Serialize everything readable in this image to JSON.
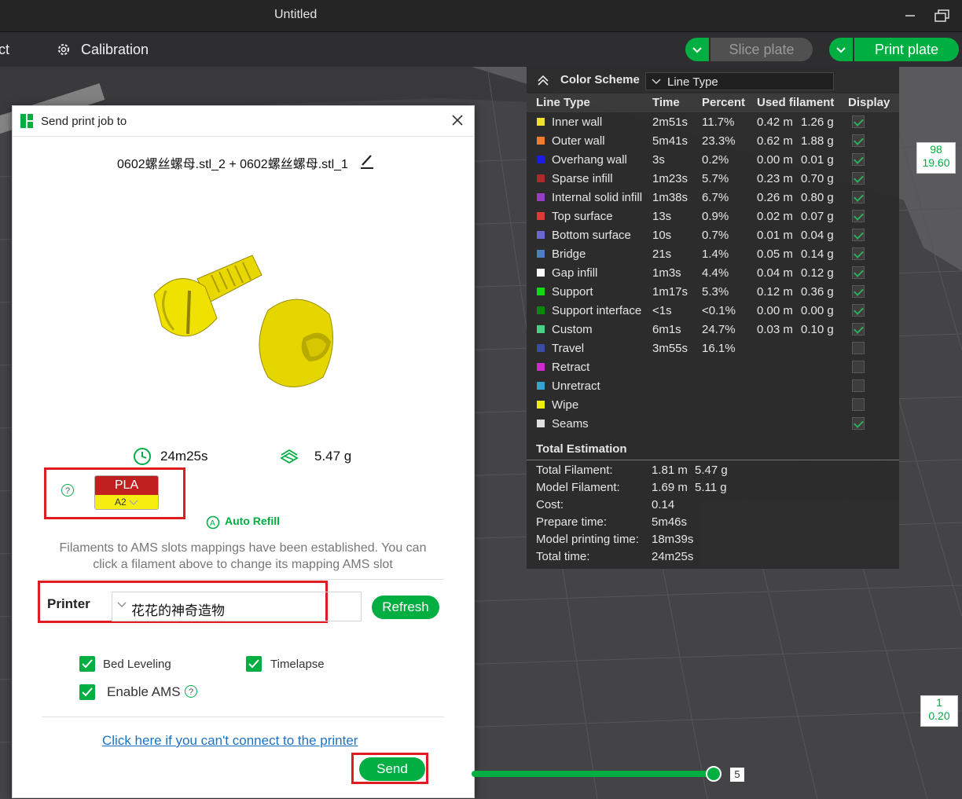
{
  "window": {
    "title": "Untitled"
  },
  "toolbar": {
    "partial_tab": "ct",
    "calibration": "Calibration",
    "slice_plate": "Slice plate",
    "print_plate": "Print plate"
  },
  "dialog": {
    "title": "Send print job to",
    "file_name": "0602螺丝螺母.stl_2 + 0602螺丝螺母.stl_1",
    "time": "24m25s",
    "weight": "5.47 g",
    "filament": {
      "type": "PLA",
      "slot": "A2",
      "color": "#c0201f",
      "slot_color": "#f5ee0e"
    },
    "help": "?",
    "auto_refill": "Auto Refill",
    "ams_message": "Filaments to AMS slots mappings have been established. You can click a filament above to change its mapping AMS slot",
    "printer_label": "Printer",
    "printer_value": "花花的神奇造物",
    "refresh": "Refresh",
    "options": {
      "bed_leveling": "Bed Leveling",
      "timelapse": "Timelapse",
      "enable_ams": "Enable AMS"
    },
    "link": "Click here if you can't connect to the printer",
    "send": "Send"
  },
  "legend": {
    "title": "Color Scheme",
    "scheme": "Line Type",
    "columns": {
      "type": "Line Type",
      "time": "Time",
      "percent": "Percent",
      "used": "Used filament",
      "display": "Display"
    },
    "rows": [
      {
        "name": "Inner wall",
        "color": "#f7e62d",
        "time": "2m51s",
        "percent": "11.7%",
        "m": "0.42 m",
        "g": "1.26 g",
        "on": true
      },
      {
        "name": "Outer wall",
        "color": "#f57f2d",
        "time": "5m41s",
        "percent": "23.3%",
        "m": "0.62 m",
        "g": "1.88 g",
        "on": true
      },
      {
        "name": "Overhang wall",
        "color": "#1a1aea",
        "time": "3s",
        "percent": "0.2%",
        "m": "0.00 m",
        "g": "0.01 g",
        "on": true
      },
      {
        "name": "Sparse infill",
        "color": "#b02b2b",
        "time": "1m23s",
        "percent": "5.7%",
        "m": "0.23 m",
        "g": "0.70 g",
        "on": true
      },
      {
        "name": "Internal solid infill",
        "color": "#9a3fc8",
        "time": "1m38s",
        "percent": "6.7%",
        "m": "0.26 m",
        "g": "0.80 g",
        "on": true
      },
      {
        "name": "Top surface",
        "color": "#e23a3a",
        "time": "13s",
        "percent": "0.9%",
        "m": "0.02 m",
        "g": "0.07 g",
        "on": true
      },
      {
        "name": "Bottom surface",
        "color": "#6b6bd6",
        "time": "10s",
        "percent": "0.7%",
        "m": "0.01 m",
        "g": "0.04 g",
        "on": true
      },
      {
        "name": "Bridge",
        "color": "#4d80c4",
        "time": "21s",
        "percent": "1.4%",
        "m": "0.05 m",
        "g": "0.14 g",
        "on": true
      },
      {
        "name": "Gap infill",
        "color": "#ffffff",
        "time": "1m3s",
        "percent": "4.4%",
        "m": "0.04 m",
        "g": "0.12 g",
        "on": true
      },
      {
        "name": "Support",
        "color": "#12e012",
        "time": "1m17s",
        "percent": "5.3%",
        "m": "0.12 m",
        "g": "0.36 g",
        "on": true
      },
      {
        "name": "Support interface",
        "color": "#0d8a0d",
        "time": "<1s",
        "percent": "<0.1%",
        "m": "0.00 m",
        "g": "0.00 g",
        "on": true
      },
      {
        "name": "Custom",
        "color": "#4bd68a",
        "time": "6m1s",
        "percent": "24.7%",
        "m": "0.03 m",
        "g": "0.10 g",
        "on": true
      },
      {
        "name": "Travel",
        "color": "#3a4da8",
        "time": "3m55s",
        "percent": "16.1%",
        "m": "",
        "g": "",
        "on": false
      },
      {
        "name": "Retract",
        "color": "#d22ad2",
        "time": "",
        "percent": "",
        "m": "",
        "g": "",
        "on": false
      },
      {
        "name": "Unretract",
        "color": "#35a9d4",
        "time": "",
        "percent": "",
        "m": "",
        "g": "",
        "on": false
      },
      {
        "name": "Wipe",
        "color": "#f3f30e",
        "time": "",
        "percent": "",
        "m": "",
        "g": "",
        "on": false
      },
      {
        "name": "Seams",
        "color": "#e6e6e6",
        "time": "",
        "percent": "",
        "m": "",
        "g": "",
        "on": true
      }
    ],
    "total_title": "Total Estimation",
    "estimates": [
      {
        "label": "Total Filament:",
        "v1": "1.81 m",
        "v2": "5.47 g"
      },
      {
        "label": "Model Filament:",
        "v1": "1.69 m",
        "v2": "5.11 g"
      },
      {
        "label": "Cost:",
        "v1": "0.14",
        "v2": ""
      },
      {
        "label": "Prepare time:",
        "v1": "5m46s",
        "v2": ""
      },
      {
        "label": "Model printing time:",
        "v1": "18m39s",
        "v2": ""
      },
      {
        "label": "Total time:",
        "v1": "24m25s",
        "v2": ""
      }
    ]
  },
  "layers": {
    "top_num": "98",
    "top_height": "19.60",
    "bottom_num": "1",
    "bottom_height": "0.20",
    "slider_value": "5"
  }
}
